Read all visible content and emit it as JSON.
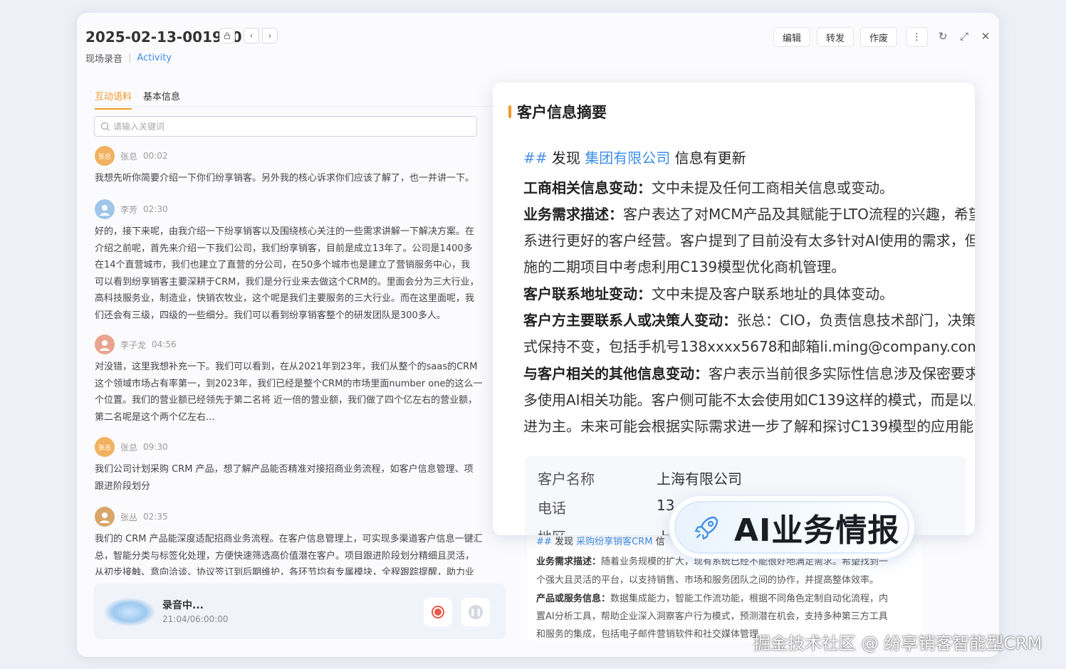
{
  "header": {
    "title": "2025-02-13-001960",
    "breadcrumb": {
      "type": "现场录音",
      "category": "Activity"
    },
    "actions": {
      "edit": "编辑",
      "forward": "转发",
      "void": "作废"
    },
    "icons": {
      "lock": "lock-icon",
      "prev": "chevron-left-icon",
      "next": "chevron-right-icon",
      "more": "more-vertical-icon",
      "refresh": "refresh-icon",
      "expand": "expand-icon",
      "close": "close-icon"
    }
  },
  "tabs": [
    {
      "label": "互动语料",
      "active": true
    },
    {
      "label": "基本信息",
      "active": false
    }
  ],
  "search": {
    "placeholder": "请输入关键词"
  },
  "messages": [
    {
      "name": "张总",
      "time": "00:02",
      "avatar": "张总",
      "lines": [
        "我想先听你简要介绍一下你们纷享销客。另外我的核心诉求你们应该了解了，也一并讲一下。"
      ]
    },
    {
      "name": "李芳",
      "time": "02:30",
      "avatar": "",
      "lines": [
        "好的，接下来呢，由我介绍一下纷享销客以及围绕核心关注的一些需求讲解一下解决方案。在",
        "介绍之前呢，首先来介绍一下我们公司，我们纷享销客，目前是成立13年了。公司是1400多",
        "在14个直营城市，我们也建立了直营的分公司，在50多个城市也是建立了营销服务中心，我",
        "可以看到纷享销客主要深耕于CRM，我们是分行业来去做这个CRM的。里面会分为三大行业，",
        "高科技服务业，制造业，快销农牧业，这个呢是我们主要服务的三大行业。而在这里面呢，我",
        "们还会有三级，四级的一些细分。我们可以看到纷享销客整个的研发团队是300多人。"
      ]
    },
    {
      "name": "李子龙",
      "time": "04:56",
      "avatar": "",
      "lines": [
        "对没错，这里我想补充一下。我们可以看到，在从2021年到23年，我们从整个的saas的CRM",
        "这个领域市场占有率第一，到2023年，我们已经是整个CRM的市场里面number one的这么一",
        "个位置。我们的营业额已经领先于第二名将 近一倍的营业额，我们做了四个亿左右的营业额，",
        "第二名呢是这个两个亿左右..."
      ]
    },
    {
      "name": "张总",
      "time": "09:30",
      "avatar": "张总",
      "lines": [
        "我们公司计划采购 CRM 产品，想了解产品能否精准对接招商业务流程，如客户信息管理、项",
        "跟进阶段划分"
      ]
    },
    {
      "name": "张丛",
      "time": "02:35",
      "avatar": "",
      "lines": [
        "我们的 CRM 产品能深度适配招商业务流程。在客户信息管理上，可实现多渠道客户信息一键汇",
        "总，智能分类与标签化处理，方便快速筛选高价值潜在客户。项目跟进阶段划分精细且灵活，",
        "从初步接触、意向洽谈、协议签订到后期维护，各环节均有专属模块，全程跟踪提醒，助力业"
      ]
    }
  ],
  "recording": {
    "status": "录音中...",
    "time": "21:04/06:00:00"
  },
  "summary": {
    "title": "客户信息摘要",
    "found": {
      "hash": "##",
      "prefix": "发现",
      "company": "集团有限公司",
      "suffix": "信息有更新"
    },
    "lines": [
      {
        "bold": "工商相关信息变动：",
        "text": "文中未提及任何工商相关信息或变动。"
      },
      {
        "bold": "业务需求描述：",
        "text": "客户表达了对MCM产品及其赋能于LTO流程的兴趣，希望"
      },
      {
        "bold": "",
        "text": "系进行更好的客户经营。客户提到了目前没有太多针对AI使用的需求，但"
      },
      {
        "bold": "",
        "text": "施的二期项目中考虑利用C139模型优化商机管理。"
      },
      {
        "bold": "客户联系地址变动：",
        "text": "文中未提及客户联系地址的具体变动。"
      },
      {
        "bold": "客户方主要联系人或决策人变动：",
        "text": "张总：CIO，负责信息技术部门，决策"
      },
      {
        "bold": "",
        "text": "式保持不变，包括手机号138xxxx5678和邮箱li.ming@company.com。"
      },
      {
        "bold": "与客户相关的其他信息变动：",
        "text": "客户表示当前很多实际性信息涉及保密要求"
      },
      {
        "bold": "",
        "text": "多使用AI相关功能。客户侧可能不太会使用如C139这样的模式，而是以主"
      },
      {
        "bold": "",
        "text": "进为主。未来可能会根据实际需求进一步了解和探讨C139模型的应用能"
      }
    ],
    "info": [
      {
        "label": "客户名称",
        "value": "上海有限公司"
      },
      {
        "label": "电话",
        "value": "13"
      },
      {
        "label": "地区",
        "value": "上"
      }
    ]
  },
  "second_panel": {
    "found": {
      "hash": "##",
      "prefix": "发现",
      "company": "采购纷享销客CRM",
      "suffix": "信"
    },
    "lines": [
      {
        "bold": "业务需求描述：",
        "text": "随着业务规模的扩大，现有系统已经不能很好地满足需求。希望找到一"
      },
      {
        "bold": "",
        "text": "个强大且灵活的平台，以支持销售、市场和服务团队之间的协作，并提高整体效率。"
      },
      {
        "bold": "产品或服务信息：",
        "text": "数据集成能力，智能工作流功能，根据不同角色定制自动化流程，内"
      },
      {
        "bold": "",
        "text": "置AI分析工具，帮助企业深入洞察客户行为模式，预测潜在机会，支持多种第三方工具"
      },
      {
        "bold": "",
        "text": "和服务的集成，包括电子邮件营销软件和社交媒体管理..."
      }
    ]
  },
  "badge": {
    "label": "AI业务情报",
    "icon": "rocket-icon"
  },
  "watermark": "掘金技术社区 @ 纷享销客智能型CRM",
  "colors": {
    "accent": "#f39a2a",
    "link": "#3f8ee8",
    "record": "#ea5a4a"
  }
}
